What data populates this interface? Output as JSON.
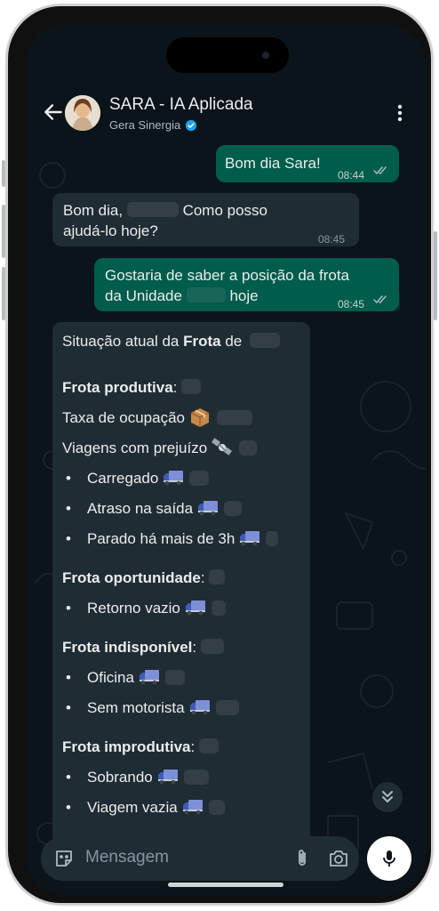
{
  "header": {
    "title": "SARA - IA Aplicada",
    "subtitle": "Gera Sinergia"
  },
  "messages": [
    {
      "type": "out",
      "text": "Bom dia Sara!",
      "time": "08:44"
    },
    {
      "type": "in",
      "text_before": "Bom dia,",
      "text_after": "Como posso",
      "line2": "ajudá-lo hoje?",
      "time": "08:45"
    },
    {
      "type": "out",
      "line1": "Gostaria de saber a posição da frota",
      "line2_before": "da Unidade",
      "line2_after": "hoje",
      "time": "08:45"
    }
  ],
  "report": {
    "intro_before": "Situação atual da ",
    "intro_bold": "Frota",
    "intro_after": " de",
    "productive": {
      "heading": "Frota produtiva",
      "occupancy": "Taxa de ocupação",
      "loss_trips": "Viagens com prejuízo",
      "items": [
        "Carregado",
        "Atraso na saída",
        "Parado há mais de 3h"
      ]
    },
    "opportunity": {
      "heading": "Frota oportunidade",
      "items": [
        "Retorno vazio"
      ]
    },
    "unavailable": {
      "heading": "Frota indisponível",
      "items": [
        "Oficina",
        "Sem motorista"
      ]
    },
    "unproductive": {
      "heading": "Frota improdutiva",
      "items": [
        "Sobrando",
        "Viagem vazia"
      ]
    },
    "bullet": "•",
    "colon": ":"
  },
  "composer": {
    "placeholder": "Mensagem"
  },
  "icons": [
    "back-arrow-icon",
    "verified-icon",
    "more-vertical-icon",
    "double-check-icon",
    "package-icon",
    "satellite-icon",
    "truck-icon",
    "sticker-icon",
    "attach-icon",
    "camera-icon",
    "mic-icon",
    "chevron-double-down-icon"
  ],
  "colors": {
    "background": "#0b141a",
    "outgoing_bubble": "#005c4b",
    "incoming_bubble": "#202c33",
    "text": "#e9edef",
    "meta_text": "#8696a0",
    "verified": "#1da1f2"
  }
}
